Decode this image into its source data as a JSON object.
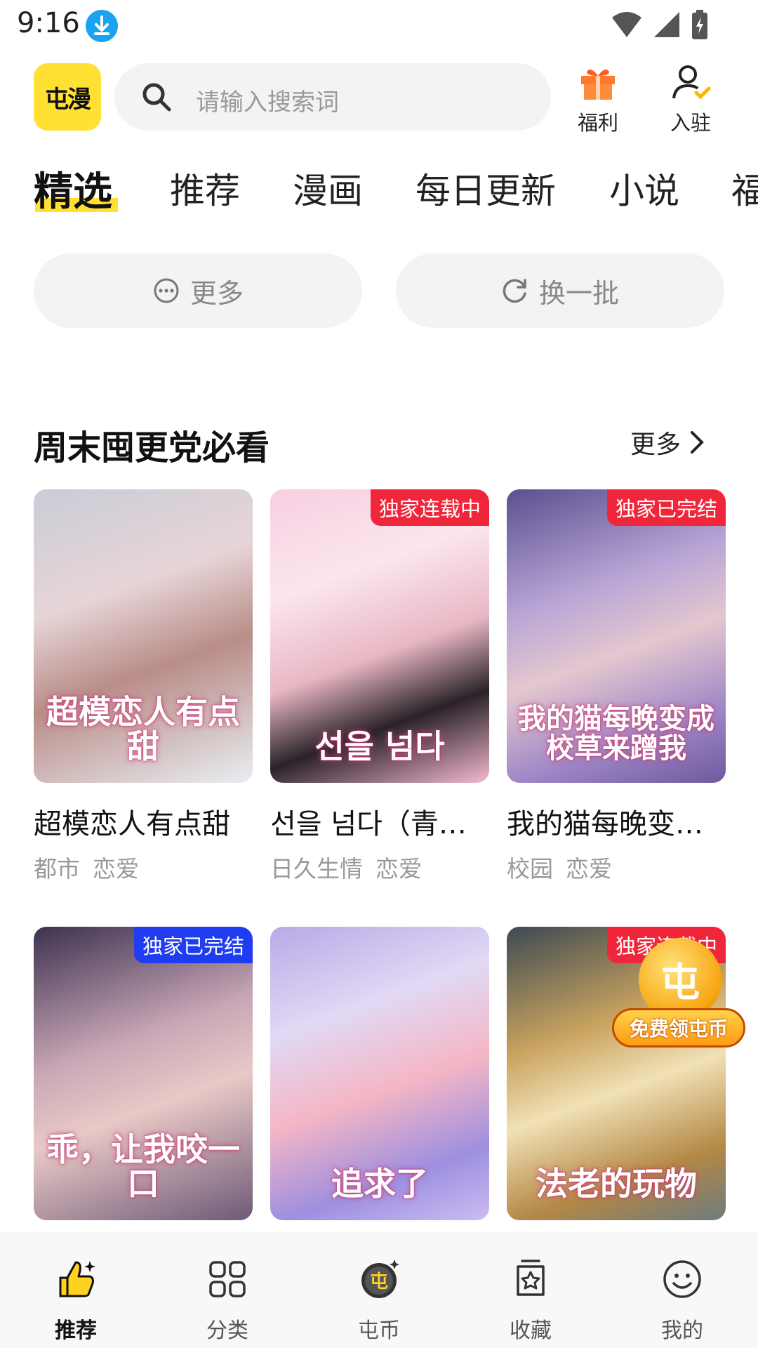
{
  "status_bar": {
    "time": "9:16"
  },
  "header": {
    "logo_text": "屯漫",
    "search_placeholder": "请输入搜索词",
    "welfare_label": "福利",
    "join_label": "入驻"
  },
  "tabs": [
    {
      "label": "精选",
      "active": true
    },
    {
      "label": "推荐",
      "active": false
    },
    {
      "label": "漫画",
      "active": false
    },
    {
      "label": "每日更新",
      "active": false
    },
    {
      "label": "小说",
      "active": false
    },
    {
      "label": "福",
      "active": false
    }
  ],
  "actions": {
    "more_label": "更多",
    "refresh_label": "换一批"
  },
  "section": {
    "title": "周末囤更党必看",
    "more_label": "更多",
    "cards": [
      {
        "title": "超模恋人有点甜",
        "tags": [
          "都市",
          "恋爱"
        ],
        "badge": "",
        "cover_text": "超模恋人有点甜"
      },
      {
        "title": "선을 넘다（青…",
        "tags": [
          "日久生情",
          "恋爱"
        ],
        "badge": "独家连载中",
        "cover_text": "선을 넘다"
      },
      {
        "title": "我的猫每晚变…",
        "tags": [
          "校园",
          "恋爱"
        ],
        "badge": "独家已完结",
        "cover_text": "我的猫每晚变成校草来蹭我"
      },
      {
        "title": "",
        "tags": [],
        "badge": "独家已完结",
        "cover_text": "乖，让我咬一口"
      },
      {
        "title": "",
        "tags": [],
        "badge": "",
        "cover_text": "追求了"
      },
      {
        "title": "",
        "tags": [],
        "badge": "独家连载中",
        "cover_text": "法老的玩物"
      }
    ]
  },
  "promo": {
    "coin_glyph": "屯",
    "label": "免费领屯币"
  },
  "bottom_nav": [
    {
      "label": "推荐",
      "icon": "thumbs-up-icon",
      "active": true
    },
    {
      "label": "分类",
      "icon": "grid-icon",
      "active": false
    },
    {
      "label": "屯币",
      "icon": "coin-icon",
      "active": false
    },
    {
      "label": "收藏",
      "icon": "bookmark-box-icon",
      "active": false
    },
    {
      "label": "我的",
      "icon": "smile-icon",
      "active": false
    }
  ],
  "colors": {
    "accent": "#ffe033",
    "badge_red": "#f0263a",
    "badge_blue": "#1f3cf0"
  }
}
